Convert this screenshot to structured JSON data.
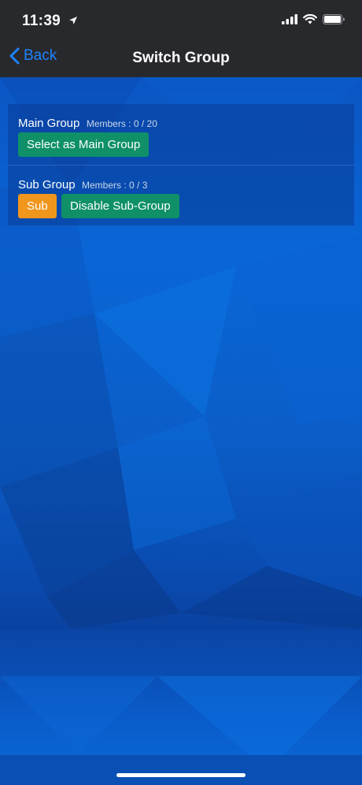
{
  "status_bar": {
    "time": "11:39"
  },
  "nav": {
    "back_label": "Back",
    "title": "Switch Group",
    "accent_color": "#1f84ff"
  },
  "groups": {
    "main": {
      "name": "Main Group",
      "members": "Members : 0 / 20",
      "select_button": "Select as Main Group"
    },
    "sub": {
      "name": "Sub Group",
      "members": "Members : 0 / 3",
      "sub_button": "Sub",
      "disable_button": "Disable Sub-Group"
    }
  },
  "colors": {
    "green_button": "#0f9068",
    "orange_button": "#f0961c",
    "bar_background": "#28292d"
  },
  "icons": [
    "location-arrow-icon",
    "signal-icon",
    "wifi-icon",
    "battery-icon",
    "chevron-left-icon"
  ]
}
